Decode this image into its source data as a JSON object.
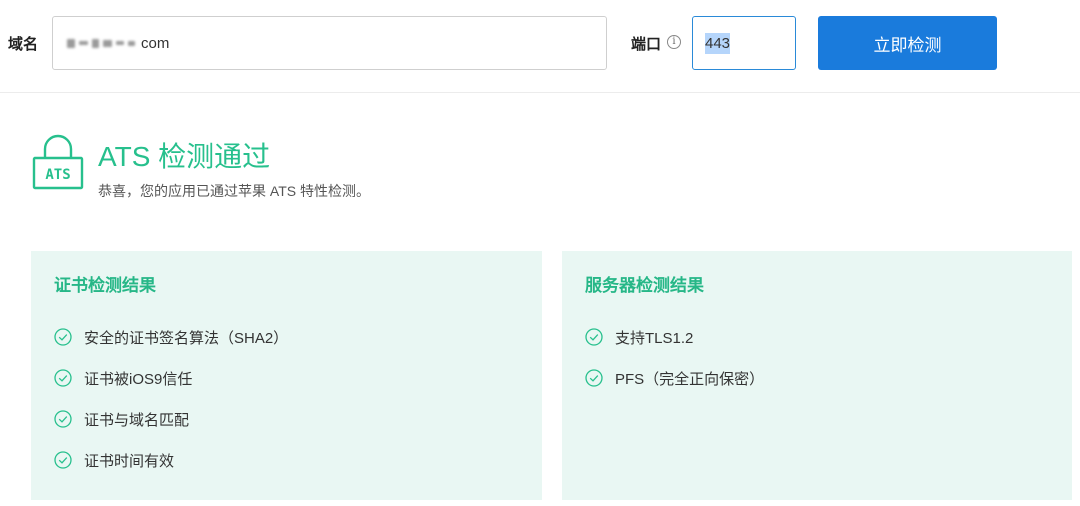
{
  "form": {
    "domain_label": "域名",
    "domain_value": "com",
    "port_label": "端口",
    "port_value": "443",
    "check_button": "立即检测"
  },
  "result": {
    "badge_text": "ATS",
    "title": "ATS 检测通过",
    "subtitle": "恭喜，您的应用已通过苹果 ATS 特性检测。"
  },
  "panels": {
    "certificate": {
      "title": "证书检测结果",
      "items": [
        "安全的证书签名算法（SHA2）",
        "证书被iOS9信任",
        "证书与域名匹配",
        "证书时间有效"
      ]
    },
    "server": {
      "title": "服务器检测结果",
      "items": [
        "支持TLS1.2",
        "PFS（完全正向保密）"
      ]
    }
  },
  "colors": {
    "accent_green": "#27c08d",
    "button_blue": "#1a7bdc",
    "panel_bg": "#e9f7f3"
  },
  "icons": {
    "info": "info-icon",
    "lock": "lock-icon",
    "check": "check-circle-icon"
  }
}
